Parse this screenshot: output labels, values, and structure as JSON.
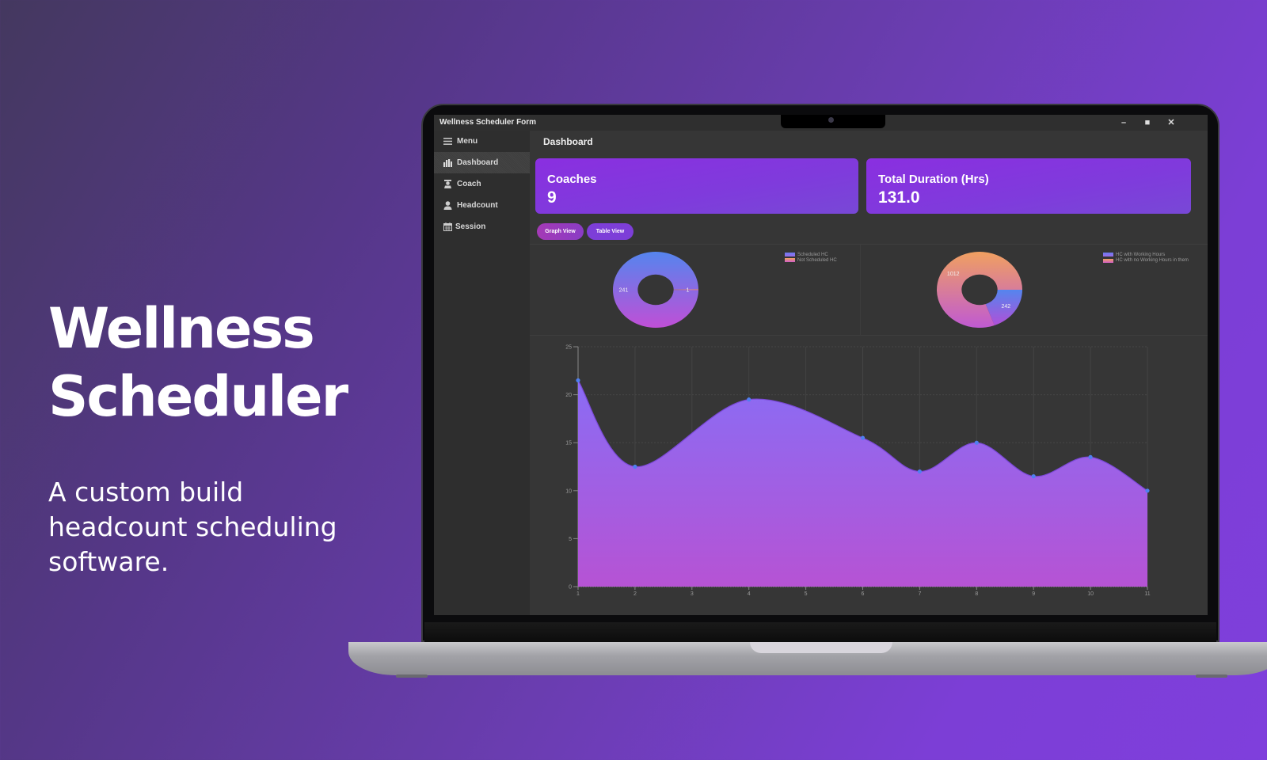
{
  "hero": {
    "title_line1": "Wellness",
    "title_line2": "Scheduler",
    "subtitle": "A custom build headcount scheduling software."
  },
  "window": {
    "title": "Wellness Scheduler Form",
    "minimize_icon": "–",
    "maximize_icon": "■",
    "close_icon": "✕"
  },
  "sidebar": {
    "menu_label": "Menu",
    "items": [
      {
        "label": "Dashboard",
        "icon": "bar-chart-icon",
        "active": true
      },
      {
        "label": "Coach",
        "icon": "coach-icon",
        "active": false
      },
      {
        "label": "Headcount",
        "icon": "person-icon",
        "active": false
      },
      {
        "label": "Session",
        "icon": "calendar-icon",
        "active": false
      }
    ]
  },
  "header": {
    "title": "Dashboard"
  },
  "cards": [
    {
      "label": "Coaches",
      "value": "9"
    },
    {
      "label": "Total Duration (Hrs)",
      "value": "131.0"
    }
  ],
  "view_buttons": {
    "graph": "Graph View",
    "table": "Table View"
  },
  "colors": {
    "accent": "#8a2fe0",
    "blue": "#5b86f0",
    "orange": "#f0a060",
    "magenta": "#c04fd6",
    "panel_bg": "#363636"
  },
  "chart_data": [
    {
      "type": "pie",
      "variant": "donut",
      "title": "",
      "slices": [
        {
          "label": "Scheduled HC",
          "value": 241
        },
        {
          "label": "Not Scheduled HC",
          "value": 1
        }
      ],
      "data_labels": [
        "241",
        "1"
      ],
      "legend": "top-right"
    },
    {
      "type": "pie",
      "variant": "donut",
      "title": "",
      "slices": [
        {
          "label": "HC with Working Hours",
          "value": 242
        },
        {
          "label": "HC with no Working Hours in them",
          "value": 1012
        }
      ],
      "data_labels": [
        "242",
        "1012"
      ],
      "legend": "top-right"
    },
    {
      "type": "area",
      "title": "",
      "xlabel": "",
      "ylabel": "",
      "x": [
        1,
        2,
        3,
        4,
        5,
        6,
        7,
        8,
        9,
        10,
        11
      ],
      "marker_x": [
        1,
        2,
        4,
        6,
        7,
        8,
        9,
        10,
        11
      ],
      "series": [
        {
          "name": "",
          "values": [
            21.5,
            12.5,
            null,
            19.5,
            null,
            15.5,
            12.0,
            15.0,
            11.5,
            13.5,
            10.0
          ]
        }
      ],
      "xticks": [
        "1",
        "2",
        "3",
        "4",
        "5",
        "6",
        "7",
        "8",
        "9",
        "10",
        "11"
      ],
      "yticks": [
        "0",
        "5",
        "10",
        "15",
        "20",
        "25"
      ],
      "ylim": [
        0,
        25
      ],
      "xlim": [
        1,
        11
      ],
      "grid": true,
      "smooth": true
    }
  ]
}
